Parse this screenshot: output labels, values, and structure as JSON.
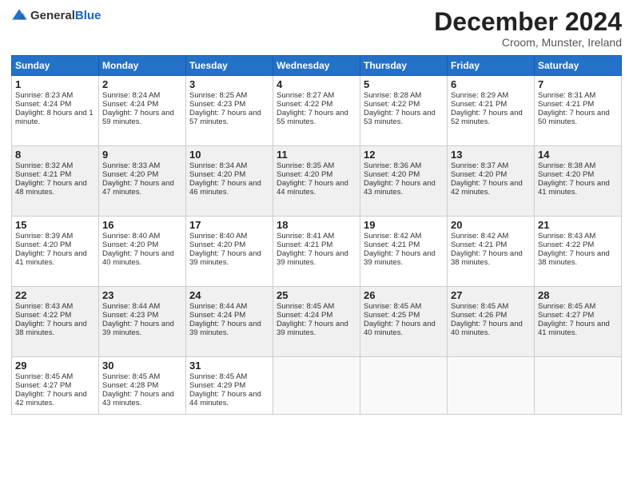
{
  "header": {
    "logo_general": "General",
    "logo_blue": "Blue",
    "month": "December 2024",
    "location": "Croom, Munster, Ireland"
  },
  "days_of_week": [
    "Sunday",
    "Monday",
    "Tuesday",
    "Wednesday",
    "Thursday",
    "Friday",
    "Saturday"
  ],
  "weeks": [
    [
      {
        "day": "1",
        "sunrise": "Sunrise: 8:23 AM",
        "sunset": "Sunset: 4:24 PM",
        "daylight": "Daylight: 8 hours and 1 minute."
      },
      {
        "day": "2",
        "sunrise": "Sunrise: 8:24 AM",
        "sunset": "Sunset: 4:24 PM",
        "daylight": "Daylight: 7 hours and 59 minutes."
      },
      {
        "day": "3",
        "sunrise": "Sunrise: 8:25 AM",
        "sunset": "Sunset: 4:23 PM",
        "daylight": "Daylight: 7 hours and 57 minutes."
      },
      {
        "day": "4",
        "sunrise": "Sunrise: 8:27 AM",
        "sunset": "Sunset: 4:22 PM",
        "daylight": "Daylight: 7 hours and 55 minutes."
      },
      {
        "day": "5",
        "sunrise": "Sunrise: 8:28 AM",
        "sunset": "Sunset: 4:22 PM",
        "daylight": "Daylight: 7 hours and 53 minutes."
      },
      {
        "day": "6",
        "sunrise": "Sunrise: 8:29 AM",
        "sunset": "Sunset: 4:21 PM",
        "daylight": "Daylight: 7 hours and 52 minutes."
      },
      {
        "day": "7",
        "sunrise": "Sunrise: 8:31 AM",
        "sunset": "Sunset: 4:21 PM",
        "daylight": "Daylight: 7 hours and 50 minutes."
      }
    ],
    [
      {
        "day": "8",
        "sunrise": "Sunrise: 8:32 AM",
        "sunset": "Sunset: 4:21 PM",
        "daylight": "Daylight: 7 hours and 48 minutes."
      },
      {
        "day": "9",
        "sunrise": "Sunrise: 8:33 AM",
        "sunset": "Sunset: 4:20 PM",
        "daylight": "Daylight: 7 hours and 47 minutes."
      },
      {
        "day": "10",
        "sunrise": "Sunrise: 8:34 AM",
        "sunset": "Sunset: 4:20 PM",
        "daylight": "Daylight: 7 hours and 46 minutes."
      },
      {
        "day": "11",
        "sunrise": "Sunrise: 8:35 AM",
        "sunset": "Sunset: 4:20 PM",
        "daylight": "Daylight: 7 hours and 44 minutes."
      },
      {
        "day": "12",
        "sunrise": "Sunrise: 8:36 AM",
        "sunset": "Sunset: 4:20 PM",
        "daylight": "Daylight: 7 hours and 43 minutes."
      },
      {
        "day": "13",
        "sunrise": "Sunrise: 8:37 AM",
        "sunset": "Sunset: 4:20 PM",
        "daylight": "Daylight: 7 hours and 42 minutes."
      },
      {
        "day": "14",
        "sunrise": "Sunrise: 8:38 AM",
        "sunset": "Sunset: 4:20 PM",
        "daylight": "Daylight: 7 hours and 41 minutes."
      }
    ],
    [
      {
        "day": "15",
        "sunrise": "Sunrise: 8:39 AM",
        "sunset": "Sunset: 4:20 PM",
        "daylight": "Daylight: 7 hours and 41 minutes."
      },
      {
        "day": "16",
        "sunrise": "Sunrise: 8:40 AM",
        "sunset": "Sunset: 4:20 PM",
        "daylight": "Daylight: 7 hours and 40 minutes."
      },
      {
        "day": "17",
        "sunrise": "Sunrise: 8:40 AM",
        "sunset": "Sunset: 4:20 PM",
        "daylight": "Daylight: 7 hours and 39 minutes."
      },
      {
        "day": "18",
        "sunrise": "Sunrise: 8:41 AM",
        "sunset": "Sunset: 4:21 PM",
        "daylight": "Daylight: 7 hours and 39 minutes."
      },
      {
        "day": "19",
        "sunrise": "Sunrise: 8:42 AM",
        "sunset": "Sunset: 4:21 PM",
        "daylight": "Daylight: 7 hours and 39 minutes."
      },
      {
        "day": "20",
        "sunrise": "Sunrise: 8:42 AM",
        "sunset": "Sunset: 4:21 PM",
        "daylight": "Daylight: 7 hours and 38 minutes."
      },
      {
        "day": "21",
        "sunrise": "Sunrise: 8:43 AM",
        "sunset": "Sunset: 4:22 PM",
        "daylight": "Daylight: 7 hours and 38 minutes."
      }
    ],
    [
      {
        "day": "22",
        "sunrise": "Sunrise: 8:43 AM",
        "sunset": "Sunset: 4:22 PM",
        "daylight": "Daylight: 7 hours and 38 minutes."
      },
      {
        "day": "23",
        "sunrise": "Sunrise: 8:44 AM",
        "sunset": "Sunset: 4:23 PM",
        "daylight": "Daylight: 7 hours and 39 minutes."
      },
      {
        "day": "24",
        "sunrise": "Sunrise: 8:44 AM",
        "sunset": "Sunset: 4:24 PM",
        "daylight": "Daylight: 7 hours and 39 minutes."
      },
      {
        "day": "25",
        "sunrise": "Sunrise: 8:45 AM",
        "sunset": "Sunset: 4:24 PM",
        "daylight": "Daylight: 7 hours and 39 minutes."
      },
      {
        "day": "26",
        "sunrise": "Sunrise: 8:45 AM",
        "sunset": "Sunset: 4:25 PM",
        "daylight": "Daylight: 7 hours and 40 minutes."
      },
      {
        "day": "27",
        "sunrise": "Sunrise: 8:45 AM",
        "sunset": "Sunset: 4:26 PM",
        "daylight": "Daylight: 7 hours and 40 minutes."
      },
      {
        "day": "28",
        "sunrise": "Sunrise: 8:45 AM",
        "sunset": "Sunset: 4:27 PM",
        "daylight": "Daylight: 7 hours and 41 minutes."
      }
    ],
    [
      {
        "day": "29",
        "sunrise": "Sunrise: 8:45 AM",
        "sunset": "Sunset: 4:27 PM",
        "daylight": "Daylight: 7 hours and 42 minutes."
      },
      {
        "day": "30",
        "sunrise": "Sunrise: 8:45 AM",
        "sunset": "Sunset: 4:28 PM",
        "daylight": "Daylight: 7 hours and 43 minutes."
      },
      {
        "day": "31",
        "sunrise": "Sunrise: 8:45 AM",
        "sunset": "Sunset: 4:29 PM",
        "daylight": "Daylight: 7 hours and 44 minutes."
      },
      null,
      null,
      null,
      null
    ]
  ]
}
